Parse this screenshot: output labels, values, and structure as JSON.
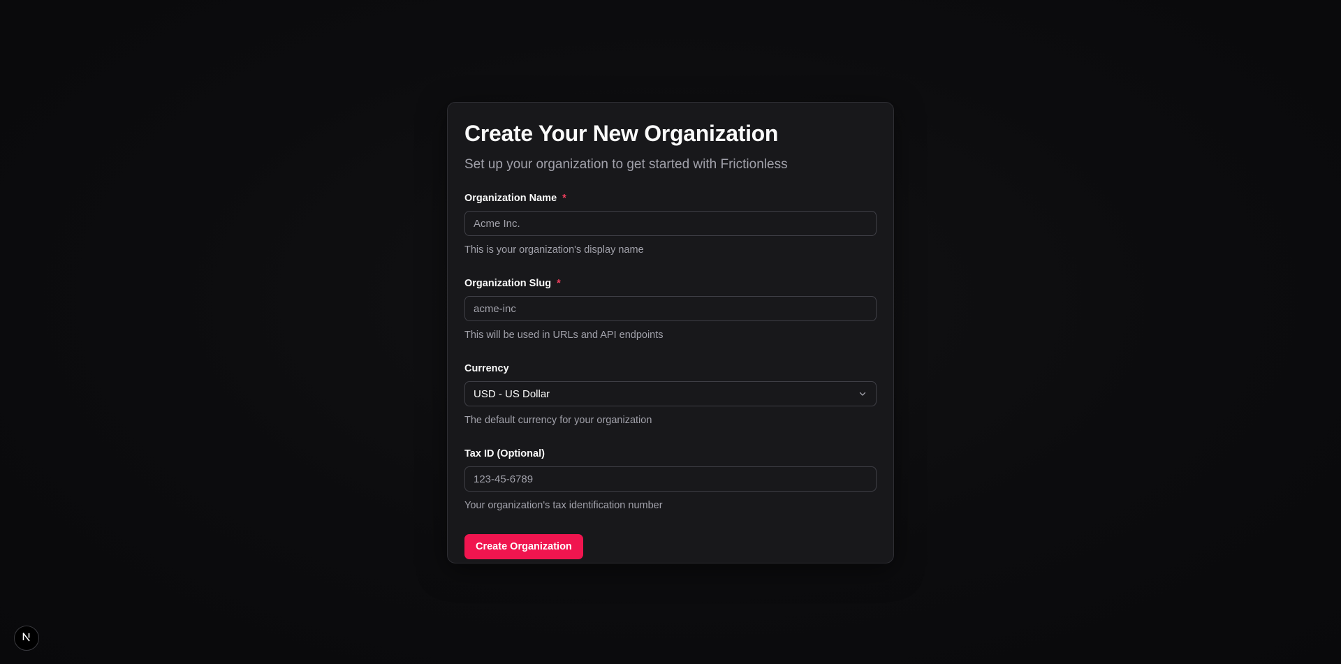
{
  "form": {
    "title": "Create Your New Organization",
    "subtitle": "Set up your organization to get started with Frictionless",
    "required_marker": "*",
    "fields": {
      "name": {
        "label": "Organization Name",
        "placeholder": "Acme Inc.",
        "value": "",
        "help": "This is your organization's display name"
      },
      "slug": {
        "label": "Organization Slug",
        "placeholder": "acme-inc",
        "value": "",
        "help": "This will be used in URLs and API endpoints"
      },
      "currency": {
        "label": "Currency",
        "selected": "USD - US Dollar",
        "help": "The default currency for your organization"
      },
      "tax_id": {
        "label": "Tax ID (Optional)",
        "placeholder": "123-45-6789",
        "value": "",
        "help": "Your organization's tax identification number"
      }
    },
    "submit_label": "Create Organization"
  },
  "badge": {
    "icon": "nextjs-logo-icon"
  },
  "colors": {
    "accent": "#f0154f",
    "required": "#f43f5e",
    "card_bg": "#18181b",
    "page_bg": "#0c0c0e"
  }
}
